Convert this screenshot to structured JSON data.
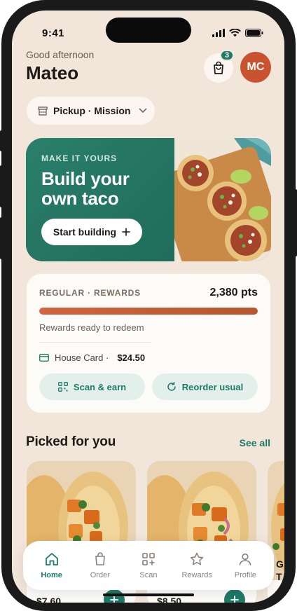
{
  "status_bar": {
    "time": "9:41"
  },
  "header": {
    "greeting": "Good afternoon",
    "name": "Mateo",
    "cart_count": "3",
    "avatar_initials": "MC"
  },
  "location": {
    "label": "Pickup · Mission"
  },
  "hero": {
    "eyebrow": "MAKE IT YOURS",
    "title": "Build your own taco",
    "button_label": "Start building"
  },
  "rewards": {
    "title": "REGULAR · REWARDS",
    "points": "2,380 pts",
    "progress": 1.0,
    "status": "Rewards ready to redeem",
    "card_label": "House Card ·",
    "card_amount": "$24.50",
    "actions": [
      {
        "label": "Scan & earn",
        "icon": "qr-icon"
      },
      {
        "label": "Reorder usual",
        "icon": "refresh-icon"
      }
    ]
  },
  "picked": {
    "title": "Picked for you",
    "see_all": "See all",
    "items": [
      {
        "price": "$7.60"
      },
      {
        "price": "$8.50"
      },
      {
        "name_partial": "G\nT"
      }
    ]
  },
  "tabs": [
    {
      "label": "Home",
      "icon": "home-icon",
      "active": true
    },
    {
      "label": "Order",
      "icon": "bag-icon",
      "active": false
    },
    {
      "label": "Scan",
      "icon": "scan-icon",
      "active": false
    },
    {
      "label": "Rewards",
      "icon": "star-icon",
      "active": false
    },
    {
      "label": "Profile",
      "icon": "person-icon",
      "active": false
    }
  ],
  "colors": {
    "accent": "#1e7a66",
    "brand_orange": "#c9532f",
    "background": "#f2e6da"
  }
}
